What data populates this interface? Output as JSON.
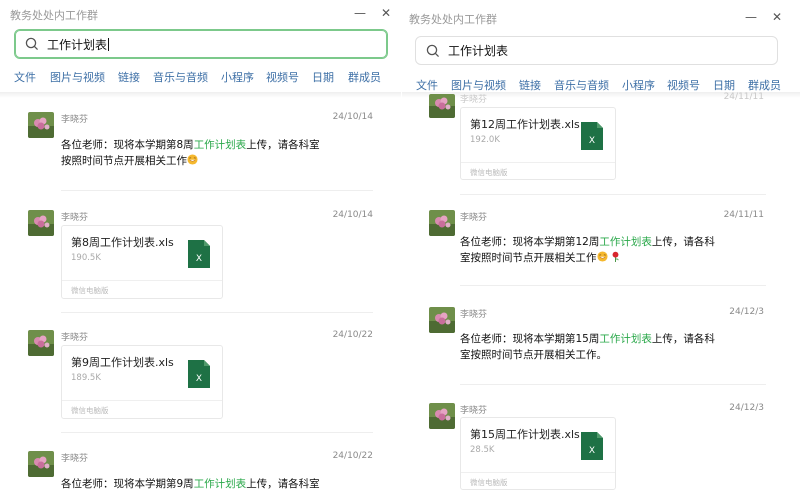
{
  "left": {
    "title": "教务处处内工作群",
    "search_value": "工作计划表",
    "tabs": [
      "文件",
      "图片与视频",
      "链接",
      "音乐与音频",
      "小程序",
      "视频号",
      "日期",
      "群成员"
    ],
    "messages": [
      {
        "sender": "李晓芬",
        "date": "24/10/14",
        "text_pre": "各位老师：现将本学期第8周",
        "text_hl": "工作计划表",
        "text_post": "上传，请各科室",
        "text_line2": "按照时间节点开展相关工作",
        "emoji": "smile"
      },
      {
        "sender": "李晓芬",
        "date": "24/10/14",
        "file": {
          "name": "第8周工作计划表.xls",
          "size": "190.5K",
          "source": "微信电脑版"
        }
      },
      {
        "sender": "李晓芬",
        "date": "24/10/22",
        "file": {
          "name": "第9周工作计划表.xls",
          "size": "189.5K",
          "source": "微信电脑版"
        }
      },
      {
        "sender": "李晓芬",
        "date": "24/10/22",
        "text_pre": "各位老师：现将本学期第9周",
        "text_hl": "工作计划表",
        "text_post": "上传，请各科室"
      }
    ]
  },
  "right": {
    "title": "教务处处内工作群",
    "search_value": "工作计划表",
    "tabs": [
      "文件",
      "图片与视频",
      "链接",
      "音乐与音频",
      "小程序",
      "视频号",
      "日期",
      "群成员"
    ],
    "top_partial_sender": "李晓芬",
    "top_partial_date": "24/11/11",
    "messages": [
      {
        "file": {
          "name": "第12周工作计划表.xls",
          "size": "192.0K",
          "source": "微信电脑版"
        }
      },
      {
        "sender": "李晓芬",
        "date": "24/11/11",
        "text_pre": "各位老师：现将本学期第12周",
        "text_hl": "工作计划表",
        "text_post": "上传，请各科",
        "text_line2": "室按照时间节点开展相关工作",
        "emoji": "smile-rose"
      },
      {
        "sender": "李晓芬",
        "date": "24/12/3",
        "text_pre": "各位老师：现将本学期第15周",
        "text_hl": "工作计划表",
        "text_post": "上传，请各科",
        "text_line2": "室按照时间节点开展相关工作。"
      },
      {
        "sender": "李晓芬",
        "date": "24/12/3",
        "file": {
          "name": "第15周工作计划表.xls",
          "size": "28.5K",
          "source": "微信电脑版"
        }
      }
    ]
  },
  "window_controls": {
    "minimize": "—",
    "close": "✕"
  },
  "icons": {
    "search": "search-icon",
    "file_type": "excel-file-icon",
    "avatar": "flower-avatar"
  },
  "colors": {
    "highlight": "#2aa84a",
    "tab_link": "#3d6fa6",
    "search_active_border": "#7cc98b",
    "excel_green": "#1e7145"
  }
}
